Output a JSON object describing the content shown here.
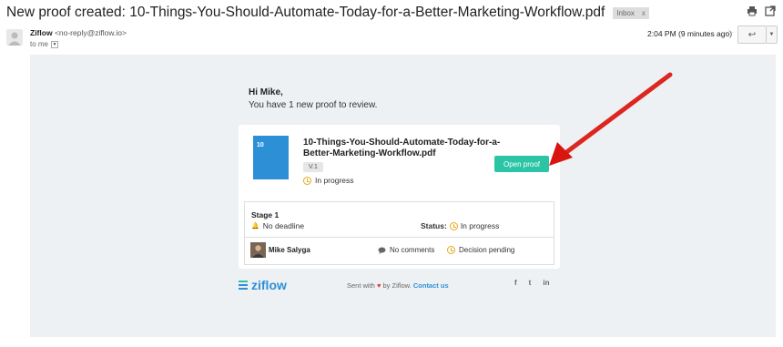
{
  "email": {
    "subject": "New proof created: 10-Things-You-Should-Automate-Today-for-a-Better-Marketing-Workflow.pdf",
    "label": "Inbox",
    "label_close": "x",
    "sender_name": "Ziflow",
    "sender_email": "<no-reply@ziflow.io>",
    "to": "to me",
    "time": "2:04 PM (9 minutes ago)",
    "icons": {
      "print": "print-icon",
      "new_window": "open-in-new-window-icon",
      "star": "star-icon",
      "reply": "reply-icon",
      "more": "more-options-icon"
    }
  },
  "body": {
    "greeting": "Hi Mike,",
    "intro": "You have 1 new proof to review.",
    "proof": {
      "thumbnail_number": "10",
      "title": "10-Things-You-Should-Automate-Today-for-a-Better-Marketing-Workflow.pdf",
      "version": "V.1",
      "status": "In progress",
      "button": "Open proof"
    },
    "stage": {
      "title": "Stage 1",
      "deadline": "No deadline",
      "status_label": "Status:",
      "status_value": "In progress",
      "reviewer": "Mike Salyga",
      "comments": "No comments",
      "decision": "Decision pending"
    },
    "footer": {
      "logo": "ziflow",
      "sent_with": "Sent with",
      "by": "by Ziflow.",
      "contact": "Contact us",
      "social": [
        "f",
        "t",
        "in"
      ]
    }
  },
  "colors": {
    "accent_green": "#2bc5a6",
    "brand_blue": "#2d90d6",
    "annotation_red": "#e8201c",
    "email_bg": "#eef1f4"
  }
}
